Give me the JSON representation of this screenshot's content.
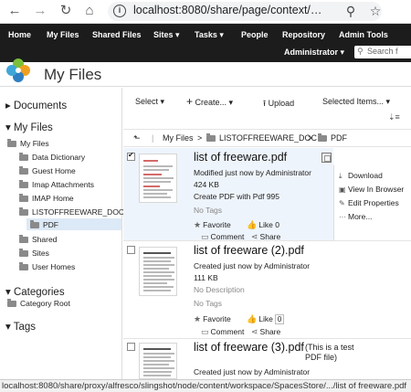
{
  "browser": {
    "url": "localhost:8080/share/page/context/mine/myfiles",
    "status_url": "localhost:8080/share/proxy/alfresco/slingshot/node/content/workspace/SpacesStore/.../list of freeware.pdf"
  },
  "top_nav": {
    "items": [
      "Home",
      "My Files",
      "Shared Files",
      "Sites ▾",
      "Tasks ▾",
      "People",
      "Repository",
      "Admin Tools"
    ],
    "user_menu": "Administrator ▾",
    "search_placeholder": "Search f"
  },
  "page": {
    "title": "My Files"
  },
  "sidebar": {
    "documents": "Documents",
    "my_files_header": "My Files",
    "tree_root": "My Files",
    "folders": [
      "Data Dictionary",
      "Guest Home",
      "Imap Attachments",
      "IMAP Home",
      "LISTOFFREEWARE_DOC"
    ],
    "subfolder": "PDF",
    "more_folders": [
      "Shared",
      "Sites",
      "User Homes"
    ],
    "categories": "Categories",
    "category_root": "Category Root",
    "tags": "Tags"
  },
  "toolbar": {
    "select": "Select ▾",
    "create": "Create... ▾",
    "upload": "Upload",
    "selected_items": "Selected Items... ▾"
  },
  "breadcrumb": {
    "root": "My Files",
    "folder": "LISTOFFREEWARE_DOC",
    "current": "PDF",
    "sep": ">"
  },
  "documents": [
    {
      "title": "list of freeware.pdf",
      "description": "",
      "modified": "Modified just now by Administrator",
      "size": "424 KB",
      "extra": "Create PDF with Pdf 995",
      "tags": "No Tags",
      "favorite": "Favorite",
      "like": "Like",
      "likes": "0",
      "comment": "Comment",
      "share": "Share"
    },
    {
      "title": "list of freeware (2).pdf",
      "description": "",
      "modified": "Created just now by Administrator",
      "size": "111 KB",
      "extra": "No Description",
      "tags": "No Tags",
      "favorite": "Favorite",
      "like": "Like",
      "likes": "0",
      "comment": "Comment",
      "share": "Share"
    },
    {
      "title": "list of freeware (3).pdf",
      "description": "(This is a test PDF file)",
      "modified": "Created just now by Administrator"
    }
  ],
  "actions_panel": {
    "items": [
      "Download",
      "View In Browser",
      "Edit Properties",
      "More..."
    ]
  }
}
